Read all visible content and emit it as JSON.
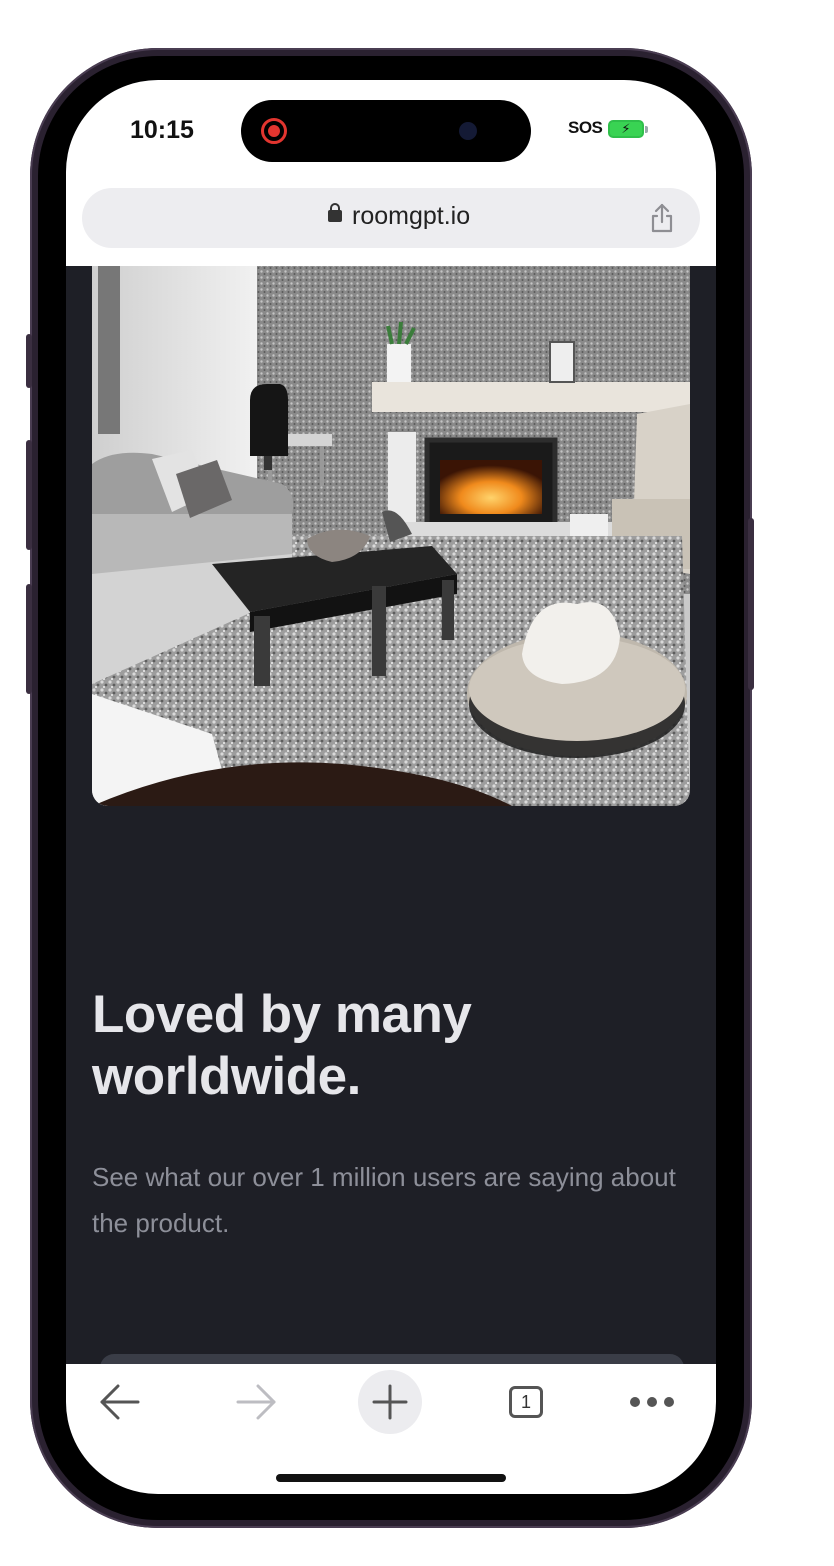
{
  "status_bar": {
    "time": "10:15",
    "sos": "SOS",
    "battery_charging": true
  },
  "browser": {
    "url": "roomgpt.io",
    "tab_count": "1"
  },
  "content": {
    "headline": "Loved by many worldwide.",
    "subtext": "See what our over 1 million users are saying about the product."
  },
  "colors": {
    "page_background": "#1e1f26",
    "headline": "#e6e6ea",
    "subtext": "#8d8f99",
    "recording_indicator": "#e2352f",
    "battery": "#39d353"
  },
  "icons": [
    "lock-icon",
    "share-icon",
    "back-arrow-icon",
    "forward-arrow-icon",
    "plus-icon",
    "tabs-icon",
    "more-icon"
  ]
}
